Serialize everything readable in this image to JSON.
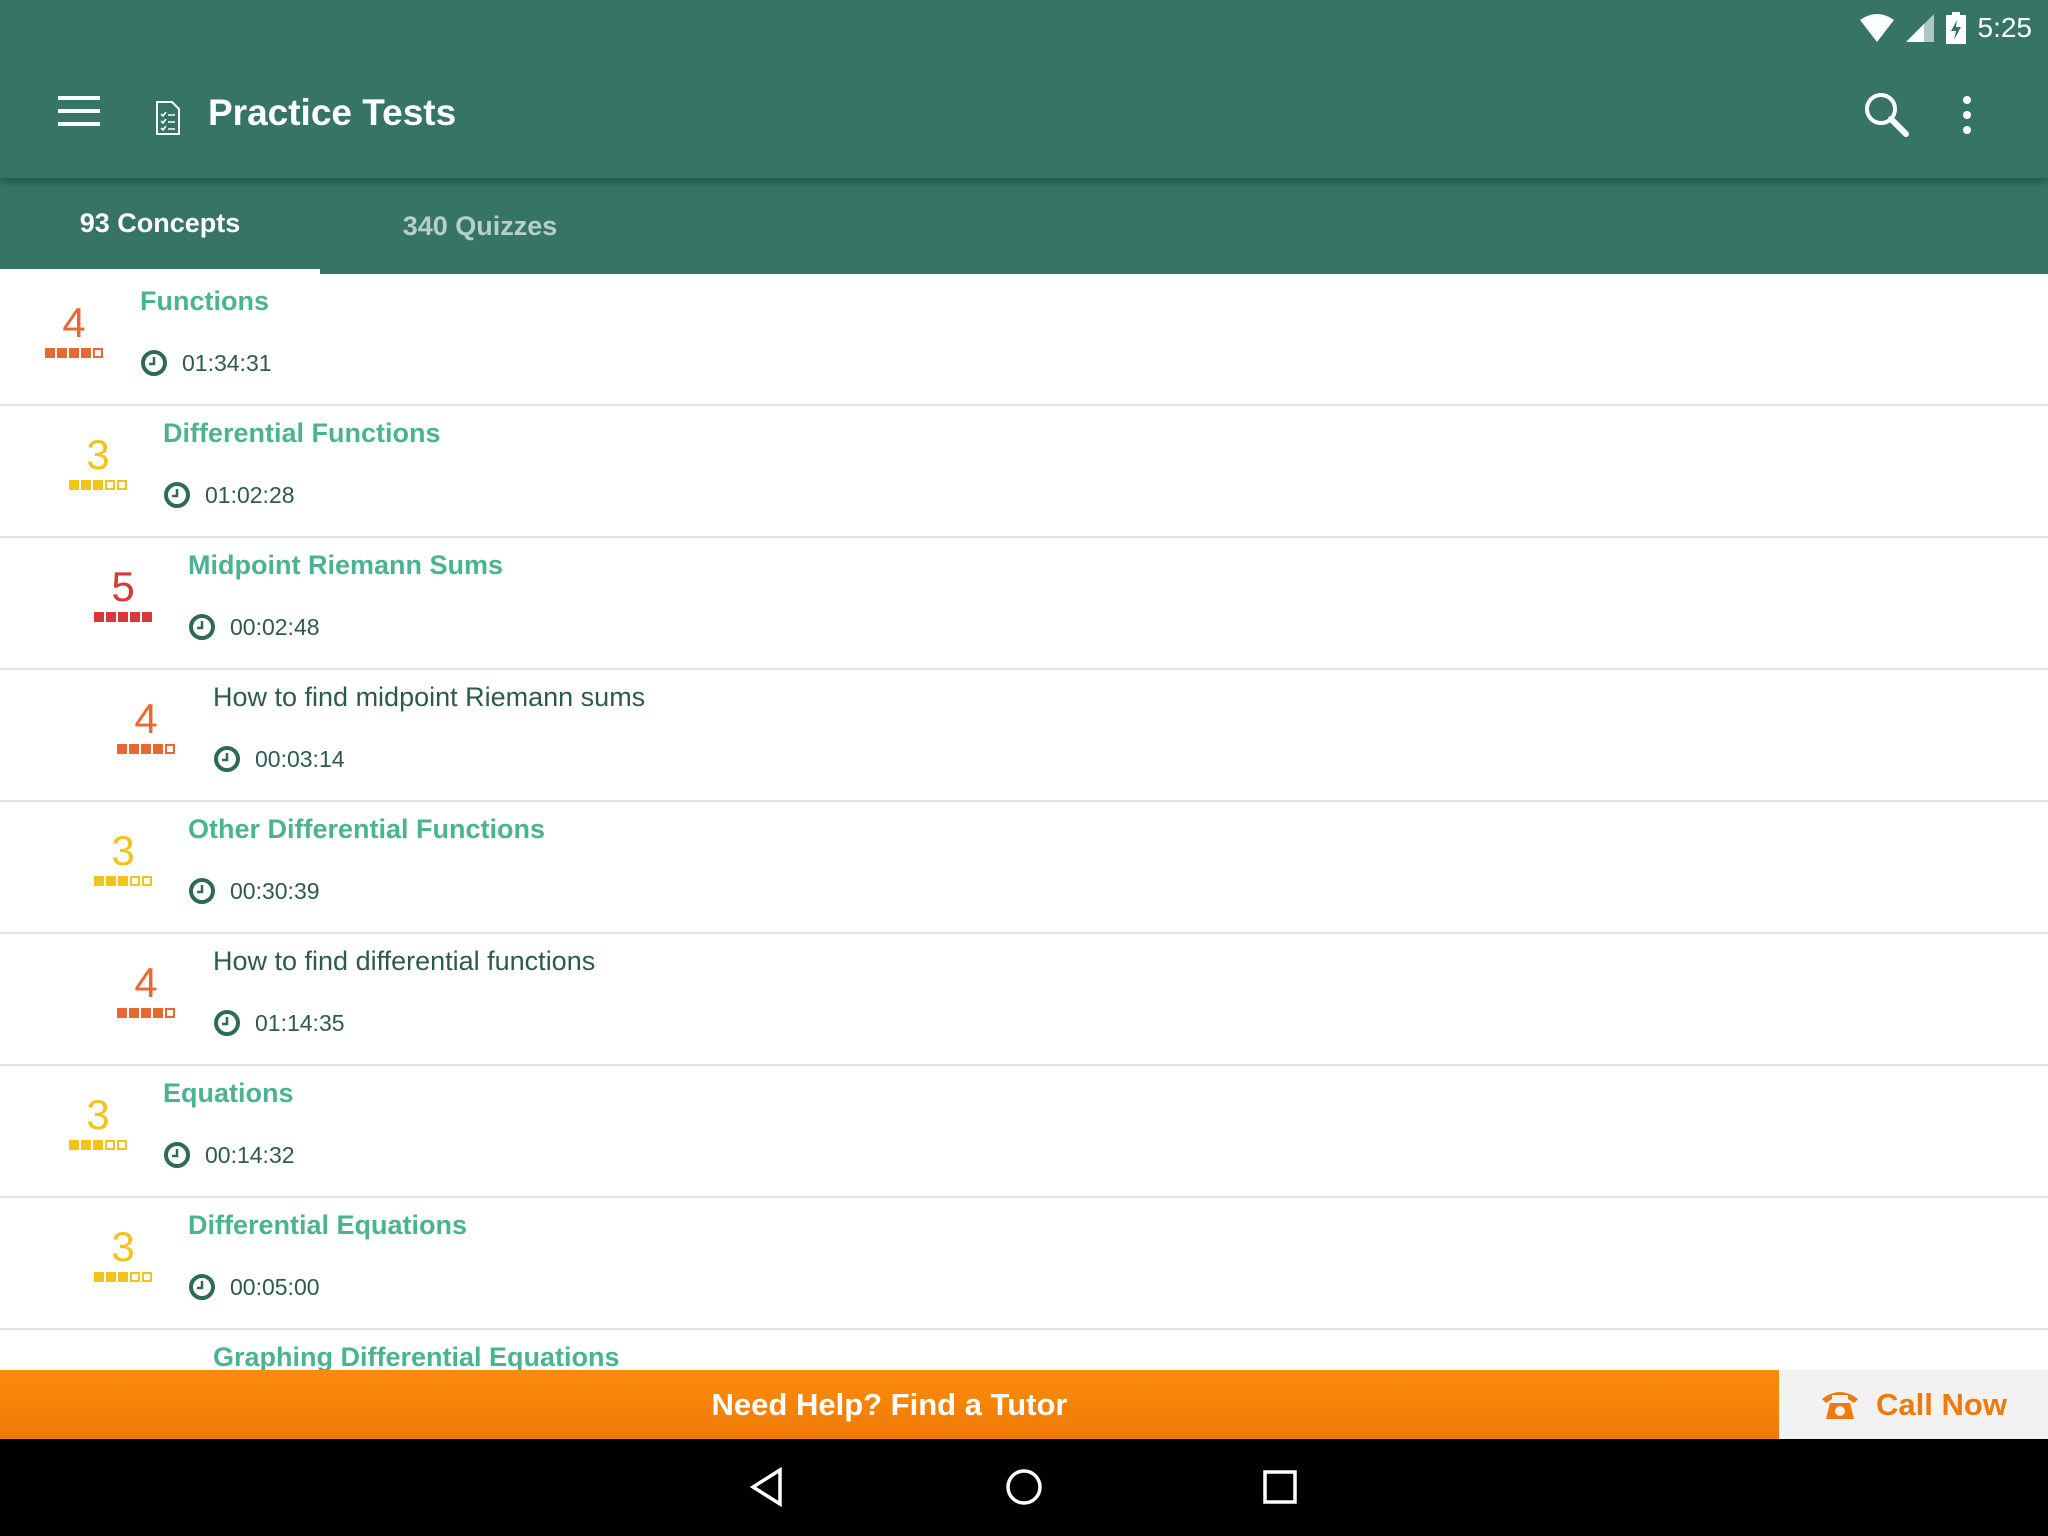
{
  "status": {
    "time": "5:25"
  },
  "appbar": {
    "title": "Practice Tests"
  },
  "tabs": [
    {
      "label": "93 Concepts",
      "active": true
    },
    {
      "label": "340 Quizzes",
      "active": false
    }
  ],
  "colors": {
    "primary": "#367565",
    "accent": "#4bb38f",
    "level5": "#d9383a",
    "level4": "#e8692f",
    "level3": "#f2c31b",
    "cta": "#f7850a"
  },
  "items": [
    {
      "title": "Functions",
      "time": "01:34:31",
      "level": 0,
      "score": 4,
      "kind": "topic"
    },
    {
      "title": "Differential Functions",
      "time": "01:02:28",
      "level": 1,
      "score": 3,
      "kind": "topic"
    },
    {
      "title": "Midpoint Riemann Sums",
      "time": "00:02:48",
      "level": 2,
      "score": 5,
      "kind": "topic"
    },
    {
      "title": "How to find midpoint Riemann sums",
      "time": "00:03:14",
      "level": 3,
      "score": 4,
      "kind": "skill"
    },
    {
      "title": "Other Differential Functions",
      "time": "00:30:39",
      "level": 2,
      "score": 3,
      "kind": "topic"
    },
    {
      "title": "How to find differential functions",
      "time": "01:14:35",
      "level": 3,
      "score": 4,
      "kind": "skill"
    },
    {
      "title": "Equations",
      "time": "00:14:32",
      "level": 1,
      "score": 3,
      "kind": "topic"
    },
    {
      "title": "Differential Equations",
      "time": "00:05:00",
      "level": 2,
      "score": 3,
      "kind": "topic"
    },
    {
      "title": "Graphing Differential Equations",
      "time": "",
      "level": 3,
      "score": null,
      "kind": "topic"
    }
  ],
  "bottom": {
    "tutor_label": "Need Help? Find a Tutor",
    "call_label": "Call Now"
  }
}
